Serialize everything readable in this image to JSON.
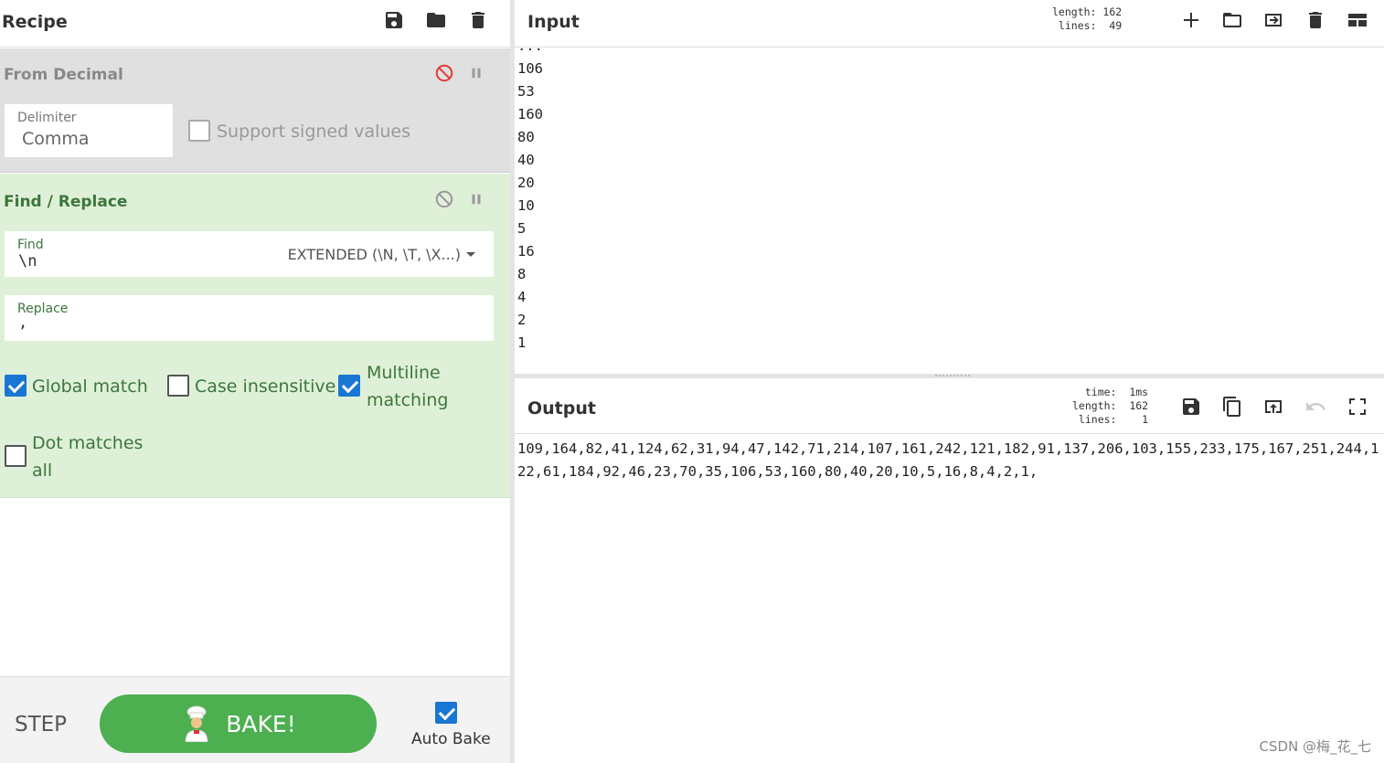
{
  "recipe": {
    "title": "Recipe",
    "icons": [
      "save-icon",
      "folder-icon",
      "trash-icon"
    ]
  },
  "operations": {
    "from_decimal": {
      "title": "From Decimal",
      "delimiter_label": "Delimiter",
      "delimiter_value": "Comma",
      "signed_label": "Support signed values",
      "signed_checked": false
    },
    "find_replace": {
      "title": "Find / Replace",
      "find_label": "Find",
      "find_value": "\\n",
      "find_mode": "EXTENDED (\\N, \\T, \\X...)",
      "replace_label": "Replace",
      "replace_value": ",",
      "global_match_label": "Global match",
      "case_insensitive_label": "Case insensitive",
      "multiline_label_1": "Multiline",
      "multiline_label_2": "matching",
      "dot_matches_label_1": "Dot matches",
      "dot_matches_label_2": "all",
      "global_match_checked": true,
      "case_insensitive_checked": false,
      "multiline_checked": true,
      "dot_matches_checked": false
    }
  },
  "controls": {
    "step_label": "STEP",
    "bake_label": "BAKE!",
    "auto_bake_label": "Auto Bake",
    "auto_bake_checked": true
  },
  "input": {
    "title": "Input",
    "length_label": "length:",
    "length_value": "162",
    "lines_label": "lines:",
    "lines_value": "49",
    "visible_lines": [
      "...",
      "106",
      "53",
      "160",
      "80",
      "40",
      "20",
      "10",
      "5",
      "16",
      "8",
      "4",
      "2",
      "1"
    ]
  },
  "output": {
    "title": "Output",
    "time_label": "time:",
    "time_value": "1ms",
    "length_label": "length:",
    "length_value": "162",
    "lines_label": "lines:",
    "lines_value": "1",
    "text": "109,164,82,41,124,62,31,94,47,142,71,214,107,161,242,121,182,91,137,206,103,155,233,175,167,251,244,122,61,184,92,46,23,70,35,106,53,160,80,40,20,10,5,16,8,4,2,1,"
  },
  "watermark": "CSDN @梅_花_七",
  "colors": {
    "bake_green": "#4caf50",
    "op_green_bg": "#dff0d8",
    "op_green_text": "#3c763d",
    "checkbox_blue": "#1976d2",
    "disable_red": "#e53935"
  }
}
